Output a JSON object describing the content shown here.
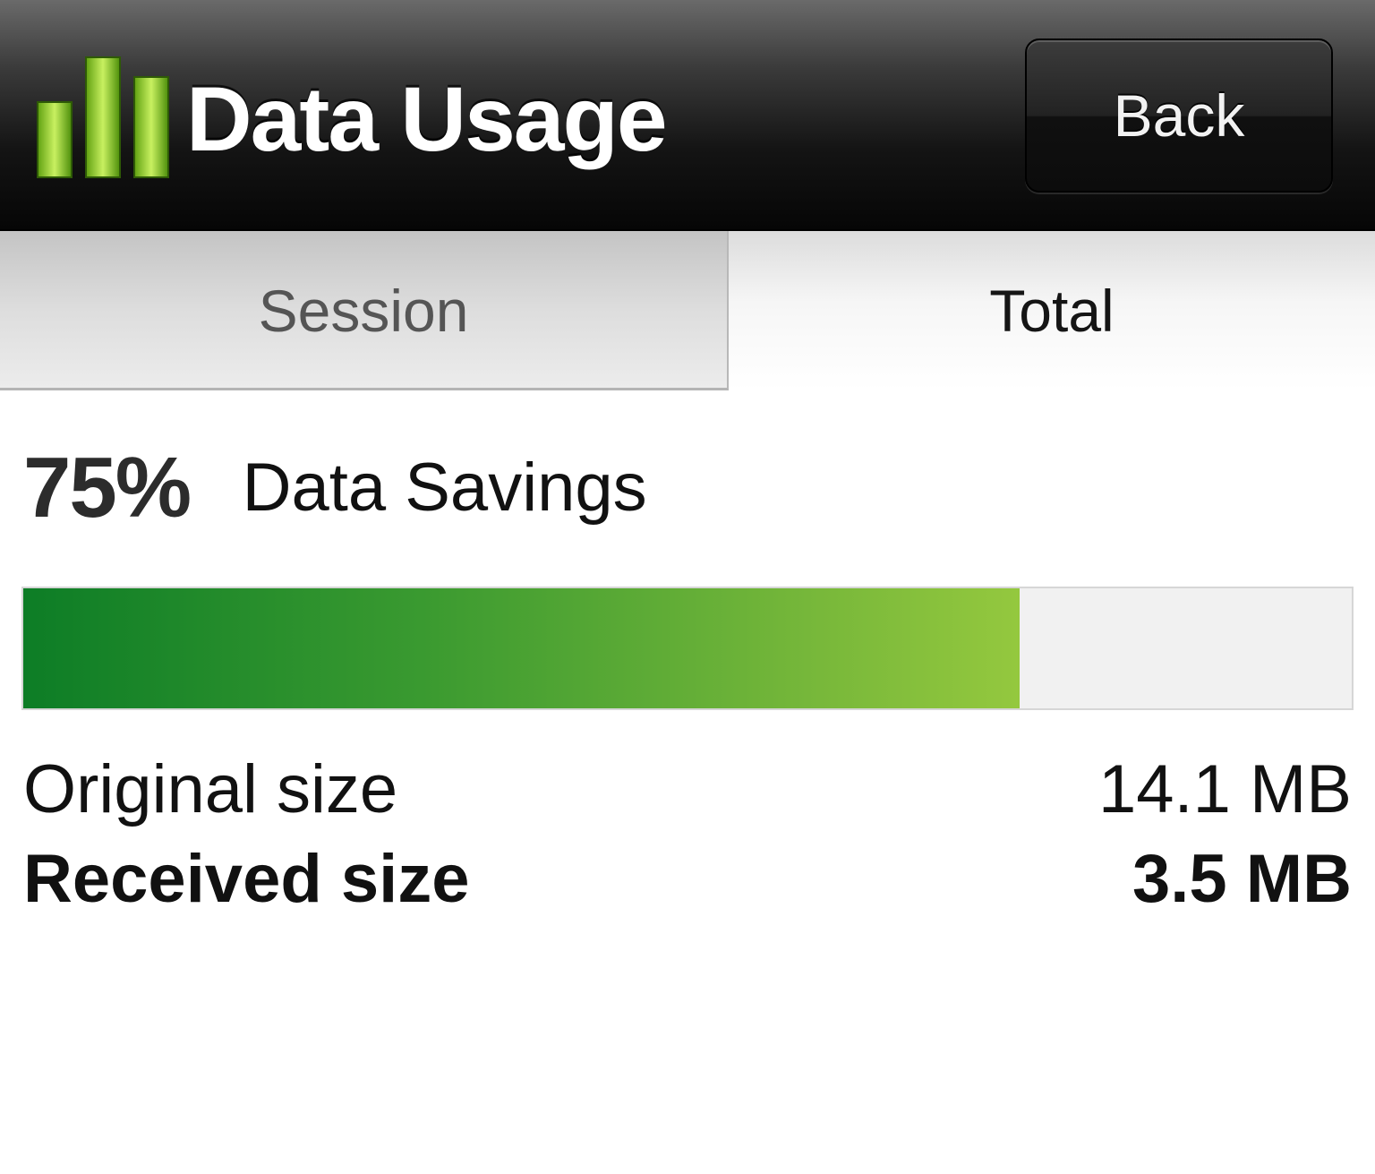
{
  "header": {
    "title": "Data Usage",
    "back_label": "Back",
    "icon": "bar-chart-icon"
  },
  "tabs": [
    {
      "label": "Session",
      "selected": false
    },
    {
      "label": "Total",
      "selected": true
    }
  ],
  "savings": {
    "percent_text": "75%",
    "label": "Data Savings",
    "bar_fraction": 0.75
  },
  "stats": {
    "original": {
      "label": "Original size",
      "value": "14.1 MB"
    },
    "received": {
      "label": "Received size",
      "value": "3.5 MB"
    }
  },
  "colors": {
    "accent_green": "#3a9a30",
    "accent_light_green": "#94c83e",
    "header_dark": "#141414"
  }
}
